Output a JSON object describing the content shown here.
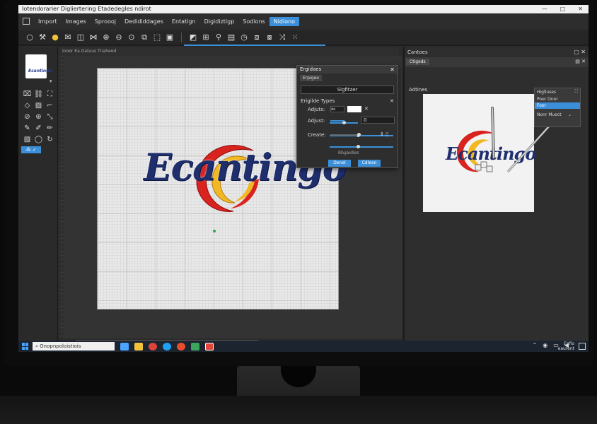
{
  "window": {
    "title": "Iotendorarier Digliertering Etadedegles ndirot"
  },
  "menu": {
    "items": [
      "Import",
      "Images",
      "Sproooj",
      "Dedididdages",
      "Entatign",
      "Digidiztigp",
      "Sodions",
      "Nidiono"
    ],
    "active_index": 7
  },
  "canvas": {
    "ruler_label": "Inoor Ea Oatuus Tnaheod",
    "logo_text": "Ecantingo"
  },
  "left_panel": {
    "thumb_logo": "Ecantingo",
    "active_tool_label": "⁂ ✓"
  },
  "dialog": {
    "title": "Ergidaes",
    "tab": "Erpigeo",
    "field_value": "Sigfitzer",
    "section_title": "Erigilde Types",
    "rows": [
      {
        "label": "Adjuts:",
        "swatch_text": "de"
      },
      {
        "label": "Adjust:",
        "value": "0"
      },
      {
        "label": "Create:"
      }
    ],
    "note": "Rbgaidles",
    "buttons": {
      "primary": "Denel",
      "secondary": "Cdlean"
    }
  },
  "right_panel": {
    "title": "Cantoes",
    "tab": "Ctigeds",
    "section_label": "Adtines",
    "preview_logo": "Ecantingo",
    "flyout": {
      "title": "Higlluses",
      "items": [
        "Poer Onor",
        "Foor",
        "Nonr Muoct"
      ],
      "selected_index": 1
    }
  },
  "taskbar": {
    "search_text": "Onopnpoloistiois",
    "clock_line1": "Eafio",
    "clock_line2": "eaurent"
  },
  "colors": {
    "accent": "#3b8fd9",
    "logo_blue": "#1f2f6e",
    "logo_red": "#d8231f",
    "logo_yellow": "#f2b824"
  }
}
